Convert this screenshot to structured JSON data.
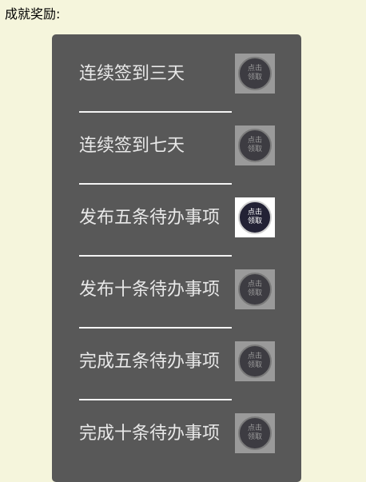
{
  "page": {
    "heading": "成就奖励:"
  },
  "colors": {
    "page_background": "#f5f5dc",
    "panel_background": "#585858",
    "label_text": "#e8e8e8",
    "divider": "#f4f4f4",
    "claim_button_idle": "#9a9a9a",
    "claim_button_active": "#ffffff",
    "claim_circle_idle": "#3d3c42",
    "claim_circle_active": "#232235"
  },
  "achievements": [
    {
      "label": "连续签到三天",
      "claim_label": "点击领取",
      "active": false
    },
    {
      "label": "连续签到七天",
      "claim_label": "点击领取",
      "active": false
    },
    {
      "label": "发布五条待办事项",
      "claim_label": "点击领取",
      "active": true
    },
    {
      "label": "发布十条待办事项",
      "claim_label": "点击领取",
      "active": false
    },
    {
      "label": "完成五条待办事项",
      "claim_label": "点击领取",
      "active": false
    },
    {
      "label": "完成十条待办事项",
      "claim_label": "点击领取",
      "active": false
    }
  ]
}
